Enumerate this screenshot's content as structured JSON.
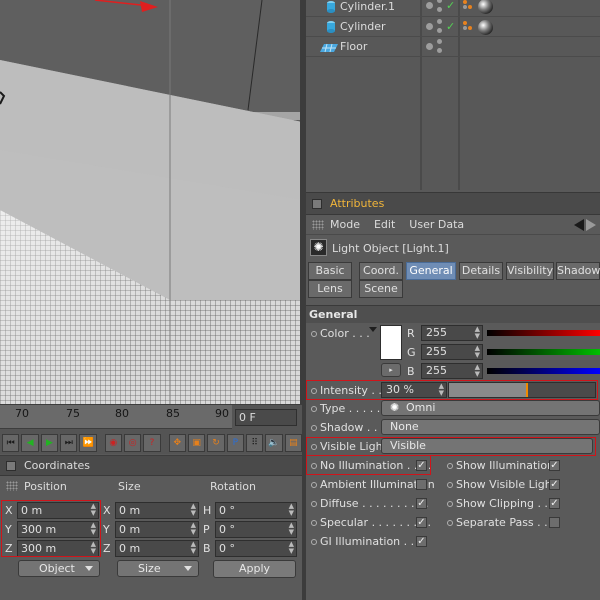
{
  "timeline": {
    "ticks": [
      "70",
      "75",
      "80",
      "85",
      "90"
    ],
    "frame": "0 F"
  },
  "coordinates": {
    "title": "Coordinates",
    "col_position": "Position",
    "col_size": "Size",
    "col_rotation": "Rotation",
    "position": [
      {
        "axis": "X",
        "value": "0 m"
      },
      {
        "axis": "Y",
        "value": "300 m"
      },
      {
        "axis": "Z",
        "value": "300 m"
      }
    ],
    "size": [
      {
        "axis": "X",
        "value": "0 m"
      },
      {
        "axis": "Y",
        "value": "0 m"
      },
      {
        "axis": "Z",
        "value": "0 m"
      }
    ],
    "rotation": [
      {
        "axis": "H",
        "value": "0 °"
      },
      {
        "axis": "P",
        "value": "0 °"
      },
      {
        "axis": "B",
        "value": "0 °"
      }
    ],
    "mode_select": "Object",
    "size_select": "Size",
    "apply_label": "Apply"
  },
  "objects": [
    {
      "name": "Cylinder.1",
      "icon": "cylinder-icon"
    },
    {
      "name": "Cylinder",
      "icon": "cylinder-icon"
    },
    {
      "name": "Floor",
      "icon": "floor-icon"
    }
  ],
  "attributes": {
    "title": "Attributes",
    "menu": [
      "Mode",
      "Edit",
      "User Data"
    ],
    "object_name": "Light Object [Light.1]",
    "tabs_row1": [
      "Basic",
      "Coord.",
      "General",
      "Details",
      "Visibility",
      "Shadow"
    ],
    "tabs_row2": [
      "Lens",
      "Scene"
    ],
    "active_tab": "General",
    "section": "General",
    "color_label": "Color . . .",
    "rgb": [
      {
        "channel": "R",
        "value": "255"
      },
      {
        "channel": "G",
        "value": "255"
      },
      {
        "channel": "B",
        "value": "255"
      }
    ],
    "intensity_label": "Intensity . . .",
    "intensity_value": "30 %",
    "intensity_fraction": 0.3,
    "type_label": "Type . . . . . .",
    "type_value": "Omni",
    "shadow_label": "Shadow . . .",
    "shadow_value": "None",
    "visible_light_label": "Visible Light",
    "visible_light_value": "Visible",
    "left_checks": [
      {
        "label": "No Illumination . . . .",
        "checked": true
      },
      {
        "label": "Ambient Illumination",
        "checked": false
      },
      {
        "label": "Diffuse . . . . . . . . . .",
        "checked": true
      },
      {
        "label": "Specular . . . . . . . . .",
        "checked": true
      },
      {
        "label": "GI Illumination . . . .",
        "checked": true
      }
    ],
    "right_checks": [
      {
        "label": "Show Illumination",
        "checked": true
      },
      {
        "label": "Show Visible Light",
        "checked": true
      },
      {
        "label": "Show Clipping . . .",
        "checked": true
      },
      {
        "label": "Separate Pass . . .",
        "checked": false
      }
    ]
  },
  "colors": {
    "accent_blue": "#6f8db5",
    "highlight_red": "#d0141a",
    "attributes_title": "#f2b63a"
  }
}
